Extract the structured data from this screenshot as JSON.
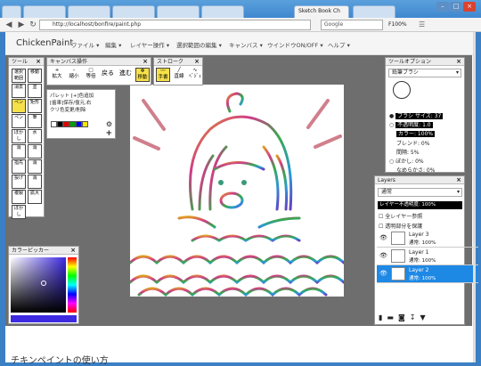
{
  "browser": {
    "tabs": [
      "",
      "",
      "",
      "",
      "",
      "",
      "Sketch Book Ch",
      ""
    ],
    "url": "http://localhost/bonfire/paint.php",
    "search_placeholder": "Google",
    "zoom": "F100%"
  },
  "app": {
    "name": "ChickenPaint",
    "menu": [
      "ファイル",
      "編集",
      "レイヤー操作",
      "選択範囲の編集",
      "キャンバス",
      "ウインドウON/OFF",
      "ヘルプ"
    ]
  },
  "tools_panel": {
    "title": "ツール",
    "tools": [
      [
        "選択範囲",
        "移動"
      ],
      [
        "消去",
        "塗"
      ],
      [
        "ペン",
        "矩形"
      ],
      [
        "ペン",
        "筆"
      ],
      [
        "ぼかし",
        "水"
      ],
      [
        "消",
        "消"
      ],
      [
        "指先",
        "消"
      ],
      [
        "投げ",
        "消"
      ],
      [
        "複製",
        "拡大"
      ],
      [
        "ぼかし",
        ""
      ]
    ]
  },
  "canvas_panel": {
    "title": "キャンバス操作",
    "buttons": [
      "拡大",
      "縮小",
      "等倍",
      "戻る",
      "進む",
      "移動"
    ]
  },
  "stroke_panel": {
    "title": "ストローク",
    "buttons": [
      "手書",
      "直線",
      "ﾍﾞｼﾞｪ"
    ]
  },
  "palette_panel": {
    "line1": "パレット [+]色追加",
    "line2": "[歯車]保存/復元,右",
    "line3": "クリ色変更/削除",
    "colors": [
      "#ffffff",
      "#000000",
      "#e60000",
      "#00a000",
      "#0000ee",
      "#f5e800"
    ]
  },
  "color_picker": {
    "title": "カラーピッカー"
  },
  "tool_options": {
    "title": "ツールオプション",
    "brush": "鉛筆ブラシ",
    "size": "ブラシ サイズ: 37",
    "opacity": "不透明度: 1.0",
    "color": "カラー: 100%",
    "blend": "ブレンド: 0%",
    "spacing": "間隔: 5%",
    "scatter": "ぼかし: 0%",
    "smoothing": "なめらかさ: 0%"
  },
  "layers": {
    "title": "Layers",
    "mode": "通常",
    "opacity": "レイヤー不透明度: 100%",
    "clip": "全レイヤー参照",
    "lock_alpha": "透明部分を保護",
    "items": [
      {
        "name": "Layer 3",
        "sub": "通常: 100%"
      },
      {
        "name": "Layer 1",
        "sub": "通常: 100%"
      },
      {
        "name": "Layer 2",
        "sub": "通常: 100%"
      }
    ]
  },
  "page": {
    "bottom_heading": "チキンペイントの使い方"
  }
}
